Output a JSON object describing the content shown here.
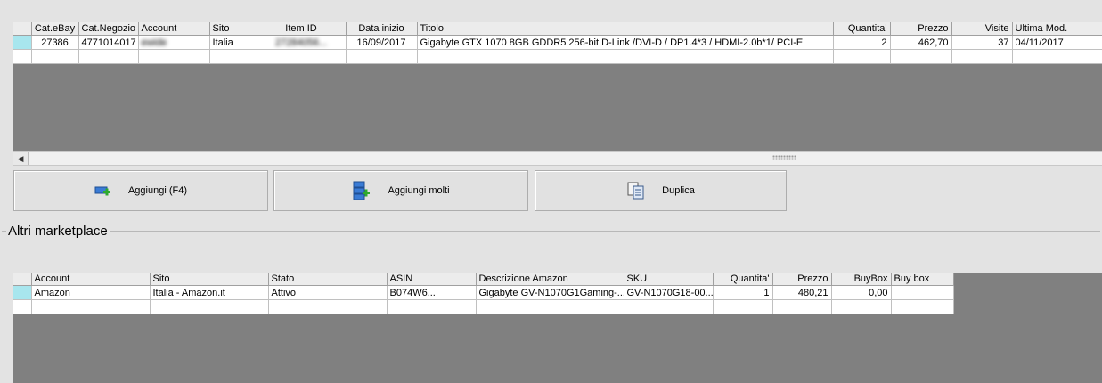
{
  "ebay_table": {
    "columns": [
      "Cat.eBay",
      "Cat.Negozio",
      "Account",
      "Sito",
      "Item ID",
      "Data inizio",
      "Titolo",
      "Quantita'",
      "Prezzo",
      "Visite",
      "Ultima Mod."
    ],
    "rows": [
      {
        "cat_ebay": "27386",
        "cat_negozio": "4771014017",
        "account": "ewide",
        "sito": "Italia",
        "item_id": "27284056...",
        "data_inizio": "16/09/2017",
        "titolo": "Gigabyte GTX 1070 8GB GDDR5 256-bit D-Link /DVI-D / DP1.4*3 / HDMI-2.0b*1/ PCI-E",
        "quantita": "2",
        "prezzo": "462,70",
        "visite": "37",
        "ultima_mod": "04/11/2017"
      }
    ]
  },
  "buttons": {
    "aggiungi": "Aggiungi (F4)",
    "aggiungi_molti": "Aggiungi molti",
    "duplica": "Duplica"
  },
  "altri_marketplace": {
    "title": "Altri marketplace",
    "columns": [
      "Account",
      "Sito",
      "Stato",
      "ASIN",
      "Descrizione Amazon",
      "SKU",
      "Quantita'",
      "Prezzo",
      "BuyBox",
      "Buy box"
    ],
    "rows": [
      {
        "account": "Amazon",
        "sito": "Italia - Amazon.it",
        "stato": "Attivo",
        "asin": "B074W6...",
        "descrizione": "Gigabyte GV-N1070G1Gaming-...",
        "sku": "GV-N1070G18-00...",
        "quantita": "1",
        "prezzo": "480,21",
        "buybox": "0,00",
        "buybox2": ""
      }
    ]
  },
  "icons": {
    "add": "add-item-icon",
    "add_many": "add-many-icon",
    "duplicate": "duplicate-icon"
  },
  "colors": {
    "selected_row_indicator": "#a8e6ee",
    "grid_background": "#808080"
  }
}
